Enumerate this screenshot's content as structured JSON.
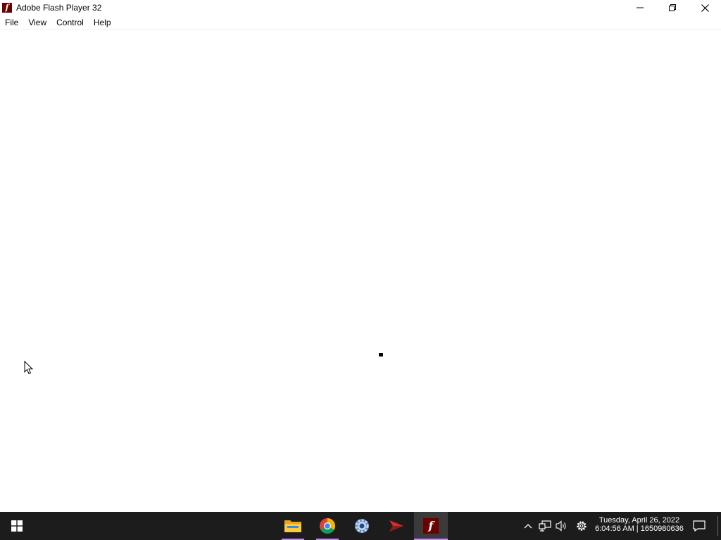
{
  "window": {
    "title": "Adobe Flash Player 32",
    "app_icon": "flash-icon",
    "controls": [
      "minimize-icon",
      "restore-icon",
      "close-icon"
    ]
  },
  "menu": {
    "items": [
      {
        "label": "File"
      },
      {
        "label": "View"
      },
      {
        "label": "Control"
      },
      {
        "label": "Help"
      }
    ]
  },
  "taskbar": {
    "start_icon": "windows-icon",
    "apps": [
      {
        "name": "file-explorer-icon",
        "running": true,
        "active": false
      },
      {
        "name": "chrome-icon",
        "running": true,
        "active": false
      },
      {
        "name": "settings-gear-icon",
        "running": false,
        "active": false
      },
      {
        "name": "red-arrow-app-icon",
        "running": false,
        "active": false
      },
      {
        "name": "flash-player-icon",
        "running": true,
        "active": true
      }
    ],
    "tray_icons": [
      "chevron-up-icon",
      "network-icon",
      "volume-icon",
      "gear-icon"
    ],
    "clock": {
      "date": "Tuesday, April 26, 2022",
      "time_line": "6:04:56 AM | 1650980636"
    },
    "notification_icon": "notification-icon"
  },
  "colors": {
    "taskbar_bg": "#1c1c1c",
    "flash_red": "#6b0000",
    "running_indicator": "#c58af0"
  }
}
